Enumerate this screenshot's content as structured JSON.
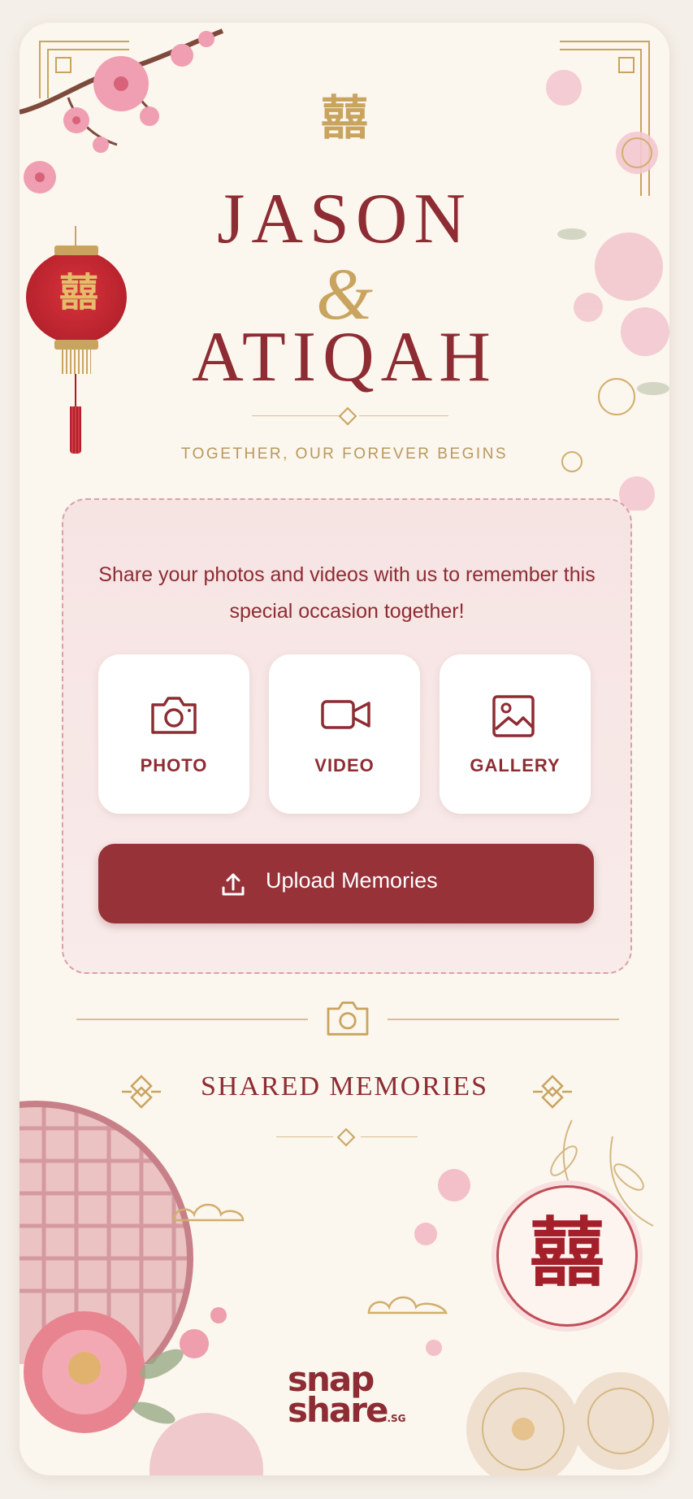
{
  "hero": {
    "symbol": "囍",
    "name_1": "JASON",
    "ampersand": "&",
    "name_2": "ATIQAH",
    "tagline": "TOGETHER, OUR FOREVER BEGINS"
  },
  "lantern": {
    "symbol": "囍"
  },
  "upload_panel": {
    "message": "Share your photos and videos with us to remember this special occasion together!",
    "options": [
      {
        "label": "PHOTO",
        "icon": "camera-icon"
      },
      {
        "label": "VIDEO",
        "icon": "video-icon"
      },
      {
        "label": "GALLERY",
        "icon": "gallery-icon"
      }
    ],
    "upload_button": {
      "label": "Upload Memories",
      "icon": "upload-icon"
    }
  },
  "divider": {
    "icon": "camera-icon"
  },
  "shared_section": {
    "title": "SHARED MEMORIES"
  },
  "emblem": {
    "symbol": "囍"
  },
  "footer": {
    "brand_line_1": "snap",
    "brand_line_2": "share",
    "brand_suffix": ".SG"
  },
  "colors": {
    "primary": "#8e2c33",
    "button": "#963238",
    "gold": "#c9a45e",
    "background": "#fbf6ee",
    "panel": "#f6e4e3"
  }
}
